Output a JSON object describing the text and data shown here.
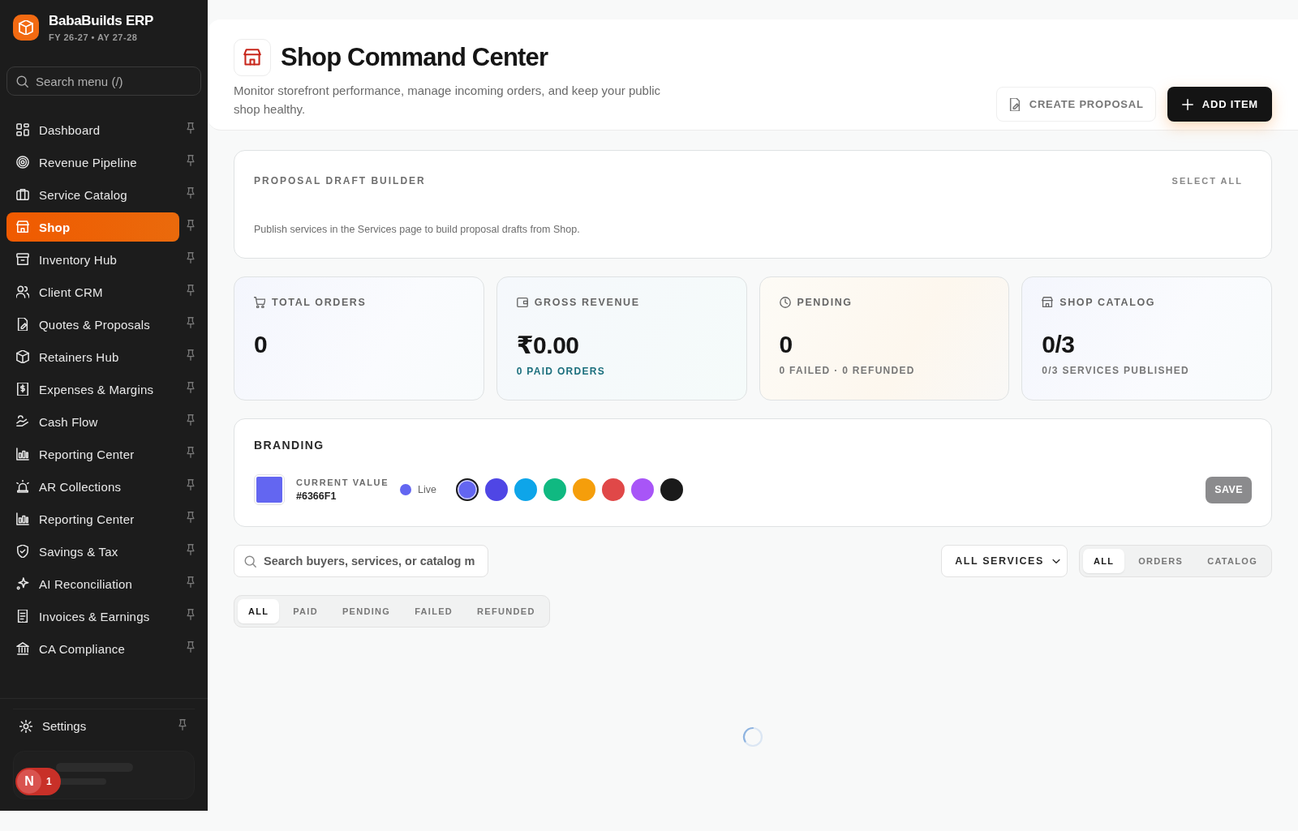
{
  "sidebar": {
    "brand": {
      "name": "BabaBuilds ERP",
      "subtitle": "FY 26-27 • AY 27-28"
    },
    "search": {
      "placeholder": "Search menu (/)"
    },
    "items": [
      {
        "label": "Dashboard",
        "selected": false
      },
      {
        "label": "Revenue Pipeline",
        "selected": false
      },
      {
        "label": "Service Catalog",
        "selected": false
      },
      {
        "label": "Shop",
        "selected": true
      },
      {
        "label": "Inventory Hub",
        "selected": false
      },
      {
        "label": "Client CRM",
        "selected": false
      },
      {
        "label": "Quotes & Proposals",
        "selected": false
      },
      {
        "label": "Retainers Hub",
        "selected": false
      },
      {
        "label": "Expenses & Margins",
        "selected": false
      },
      {
        "label": "Cash Flow",
        "selected": false
      },
      {
        "label": "Reporting Center",
        "selected": false
      },
      {
        "label": "AR Collections",
        "selected": false
      },
      {
        "label": "Reporting Center",
        "selected": false
      },
      {
        "label": "Savings & Tax",
        "selected": false
      },
      {
        "label": "AI Reconciliation",
        "selected": false
      },
      {
        "label": "Invoices & Earnings",
        "selected": false
      },
      {
        "label": "CA Compliance",
        "selected": false
      }
    ],
    "settings": {
      "label": "Settings"
    },
    "dev_badge": {
      "letter": "N",
      "count": "1"
    }
  },
  "header": {
    "title": "Shop Command Center",
    "subtitle": "Monitor storefront performance, manage incoming orders, and keep your public shop healthy.",
    "buttons": [
      {
        "label": "CREATE PROPOSAL",
        "kind": "secondary"
      },
      {
        "label": "ADD ITEM",
        "kind": "primary"
      }
    ]
  },
  "proposal_builder": {
    "title": "PROPOSAL DRAFT BUILDER",
    "action": "SELECT ALL",
    "message": "Publish services in the Services page to build proposal drafts from Shop."
  },
  "stats": [
    {
      "kind": "cart",
      "label": "TOTAL ORDERS",
      "value": "0"
    },
    {
      "kind": "wallet",
      "label": "GROSS REVENUE",
      "value": "₹0.00",
      "sub": "0 PAID ORDERS",
      "highlight": true
    },
    {
      "kind": "clock",
      "label": "PENDING",
      "value": "0",
      "sub": "0 FAILED · 0 REFUNDED",
      "highlight": false
    },
    {
      "kind": "store",
      "label": "SHOP CATALOG",
      "value": "0/3",
      "sub": "0/3 SERVICES PUBLISHED",
      "highlight": false
    }
  ],
  "branding": {
    "title": "BRANDING",
    "current_label": "CURRENT VALUE",
    "current_value": "#6366F1",
    "status": "Live",
    "save": "SAVE",
    "swatches": [
      {
        "color": "#6366f1",
        "selected": true
      },
      {
        "color": "#4f46e5",
        "selected": false
      },
      {
        "color": "#0ea5e9",
        "selected": false
      },
      {
        "color": "#10b981",
        "selected": false
      },
      {
        "color": "#f59e0b",
        "selected": false
      },
      {
        "color": "#e04848",
        "selected": false
      },
      {
        "color": "#a855f7",
        "selected": false
      },
      {
        "color": "#1a1a1a",
        "selected": false
      }
    ]
  },
  "filters": {
    "search": {
      "placeholder": "Search buyers, services, or catalog m"
    },
    "service_select": "ALL SERVICES",
    "view_tabs": [
      {
        "label": "ALL",
        "selected": true
      },
      {
        "label": "ORDERS",
        "selected": false
      },
      {
        "label": "CATALOG",
        "selected": false
      }
    ],
    "status_tabs": [
      {
        "label": "ALL",
        "selected": true
      },
      {
        "label": "PAID",
        "selected": false
      },
      {
        "label": "PENDING",
        "selected": false
      },
      {
        "label": "FAILED",
        "selected": false
      },
      {
        "label": "REFUNDED",
        "selected": false
      }
    ]
  }
}
